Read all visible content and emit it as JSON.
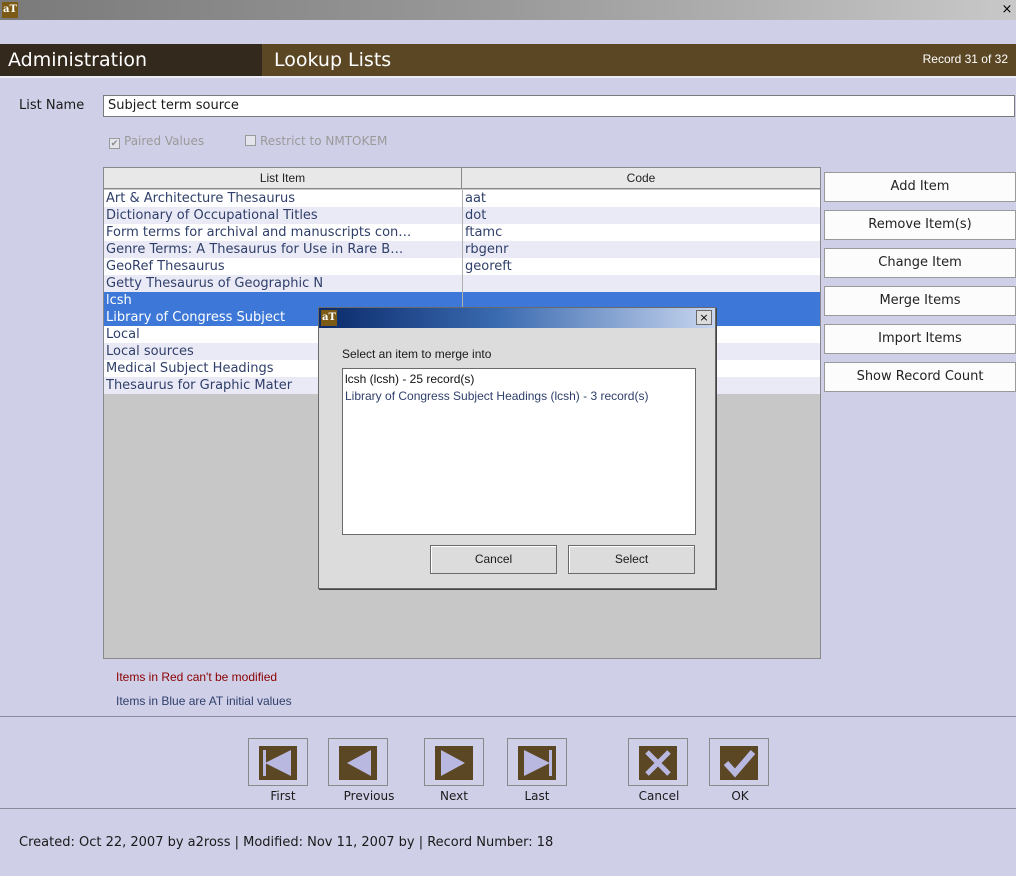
{
  "window": {
    "logo": "aT",
    "close_glyph": "×"
  },
  "header": {
    "section": "Administration",
    "title": "Lookup Lists",
    "record": "Record 31 of 32"
  },
  "form": {
    "list_name_label": "List Name",
    "list_name_value": "Subject term source",
    "paired_values": {
      "label": "Paired Values",
      "checked": true
    },
    "restrict_nmtokem": {
      "label": "Restrict to NMTOKEM",
      "checked": false
    }
  },
  "table": {
    "columns": [
      "List Item",
      "Code"
    ],
    "rows": [
      {
        "item": "Art & Architecture Thesaurus",
        "code": "aat"
      },
      {
        "item": "Dictionary of Occupational Titles",
        "code": "dot"
      },
      {
        "item": "Form terms for archival and manuscripts con…",
        "code": "ftamc"
      },
      {
        "item": "Genre Terms: A Thesaurus for Use in Rare B…",
        "code": "rbgenr"
      },
      {
        "item": "GeoRef Thesaurus",
        "code": "georeft"
      },
      {
        "item": "Getty Thesaurus of Geographic N",
        "code": ""
      },
      {
        "item": "lcsh",
        "code": ""
      },
      {
        "item": "Library of Congress Subject",
        "code": ""
      },
      {
        "item": "Local",
        "code": ""
      },
      {
        "item": "Local sources",
        "code": ""
      },
      {
        "item": "Medical Subject Headings",
        "code": ""
      },
      {
        "item": "Thesaurus for Graphic Mater",
        "code": ""
      }
    ]
  },
  "side_buttons": {
    "add": "Add Item",
    "remove": "Remove Item(s)",
    "change": "Change Item",
    "merge": "Merge Items",
    "import": "Import Items",
    "count": "Show Record Count"
  },
  "legend": {
    "red": "Items in Red can't be modified",
    "blue": "Items in Blue are AT initial values"
  },
  "nav": {
    "first": "First",
    "previous": "Previous",
    "next": "Next",
    "last": "Last",
    "cancel": "Cancel",
    "ok": "OK"
  },
  "footer": "Created: Oct 22, 2007 by a2ross | Modified: Nov 11, 2007 by  | Record Number: 18",
  "dialog": {
    "logo": "aT",
    "close_glyph": "×",
    "prompt": "Select an item to merge into",
    "items": [
      "lcsh (lcsh) - 25 record(s)",
      "Library of Congress Subject Headings (lcsh) - 3 record(s)"
    ],
    "cancel": "Cancel",
    "select": "Select"
  },
  "colors": {
    "header_bg": "#5b4724",
    "selection": "#3d78d8",
    "initial_value_text": "#2f3f6a",
    "unmodifiable_text": "#8b0000"
  }
}
